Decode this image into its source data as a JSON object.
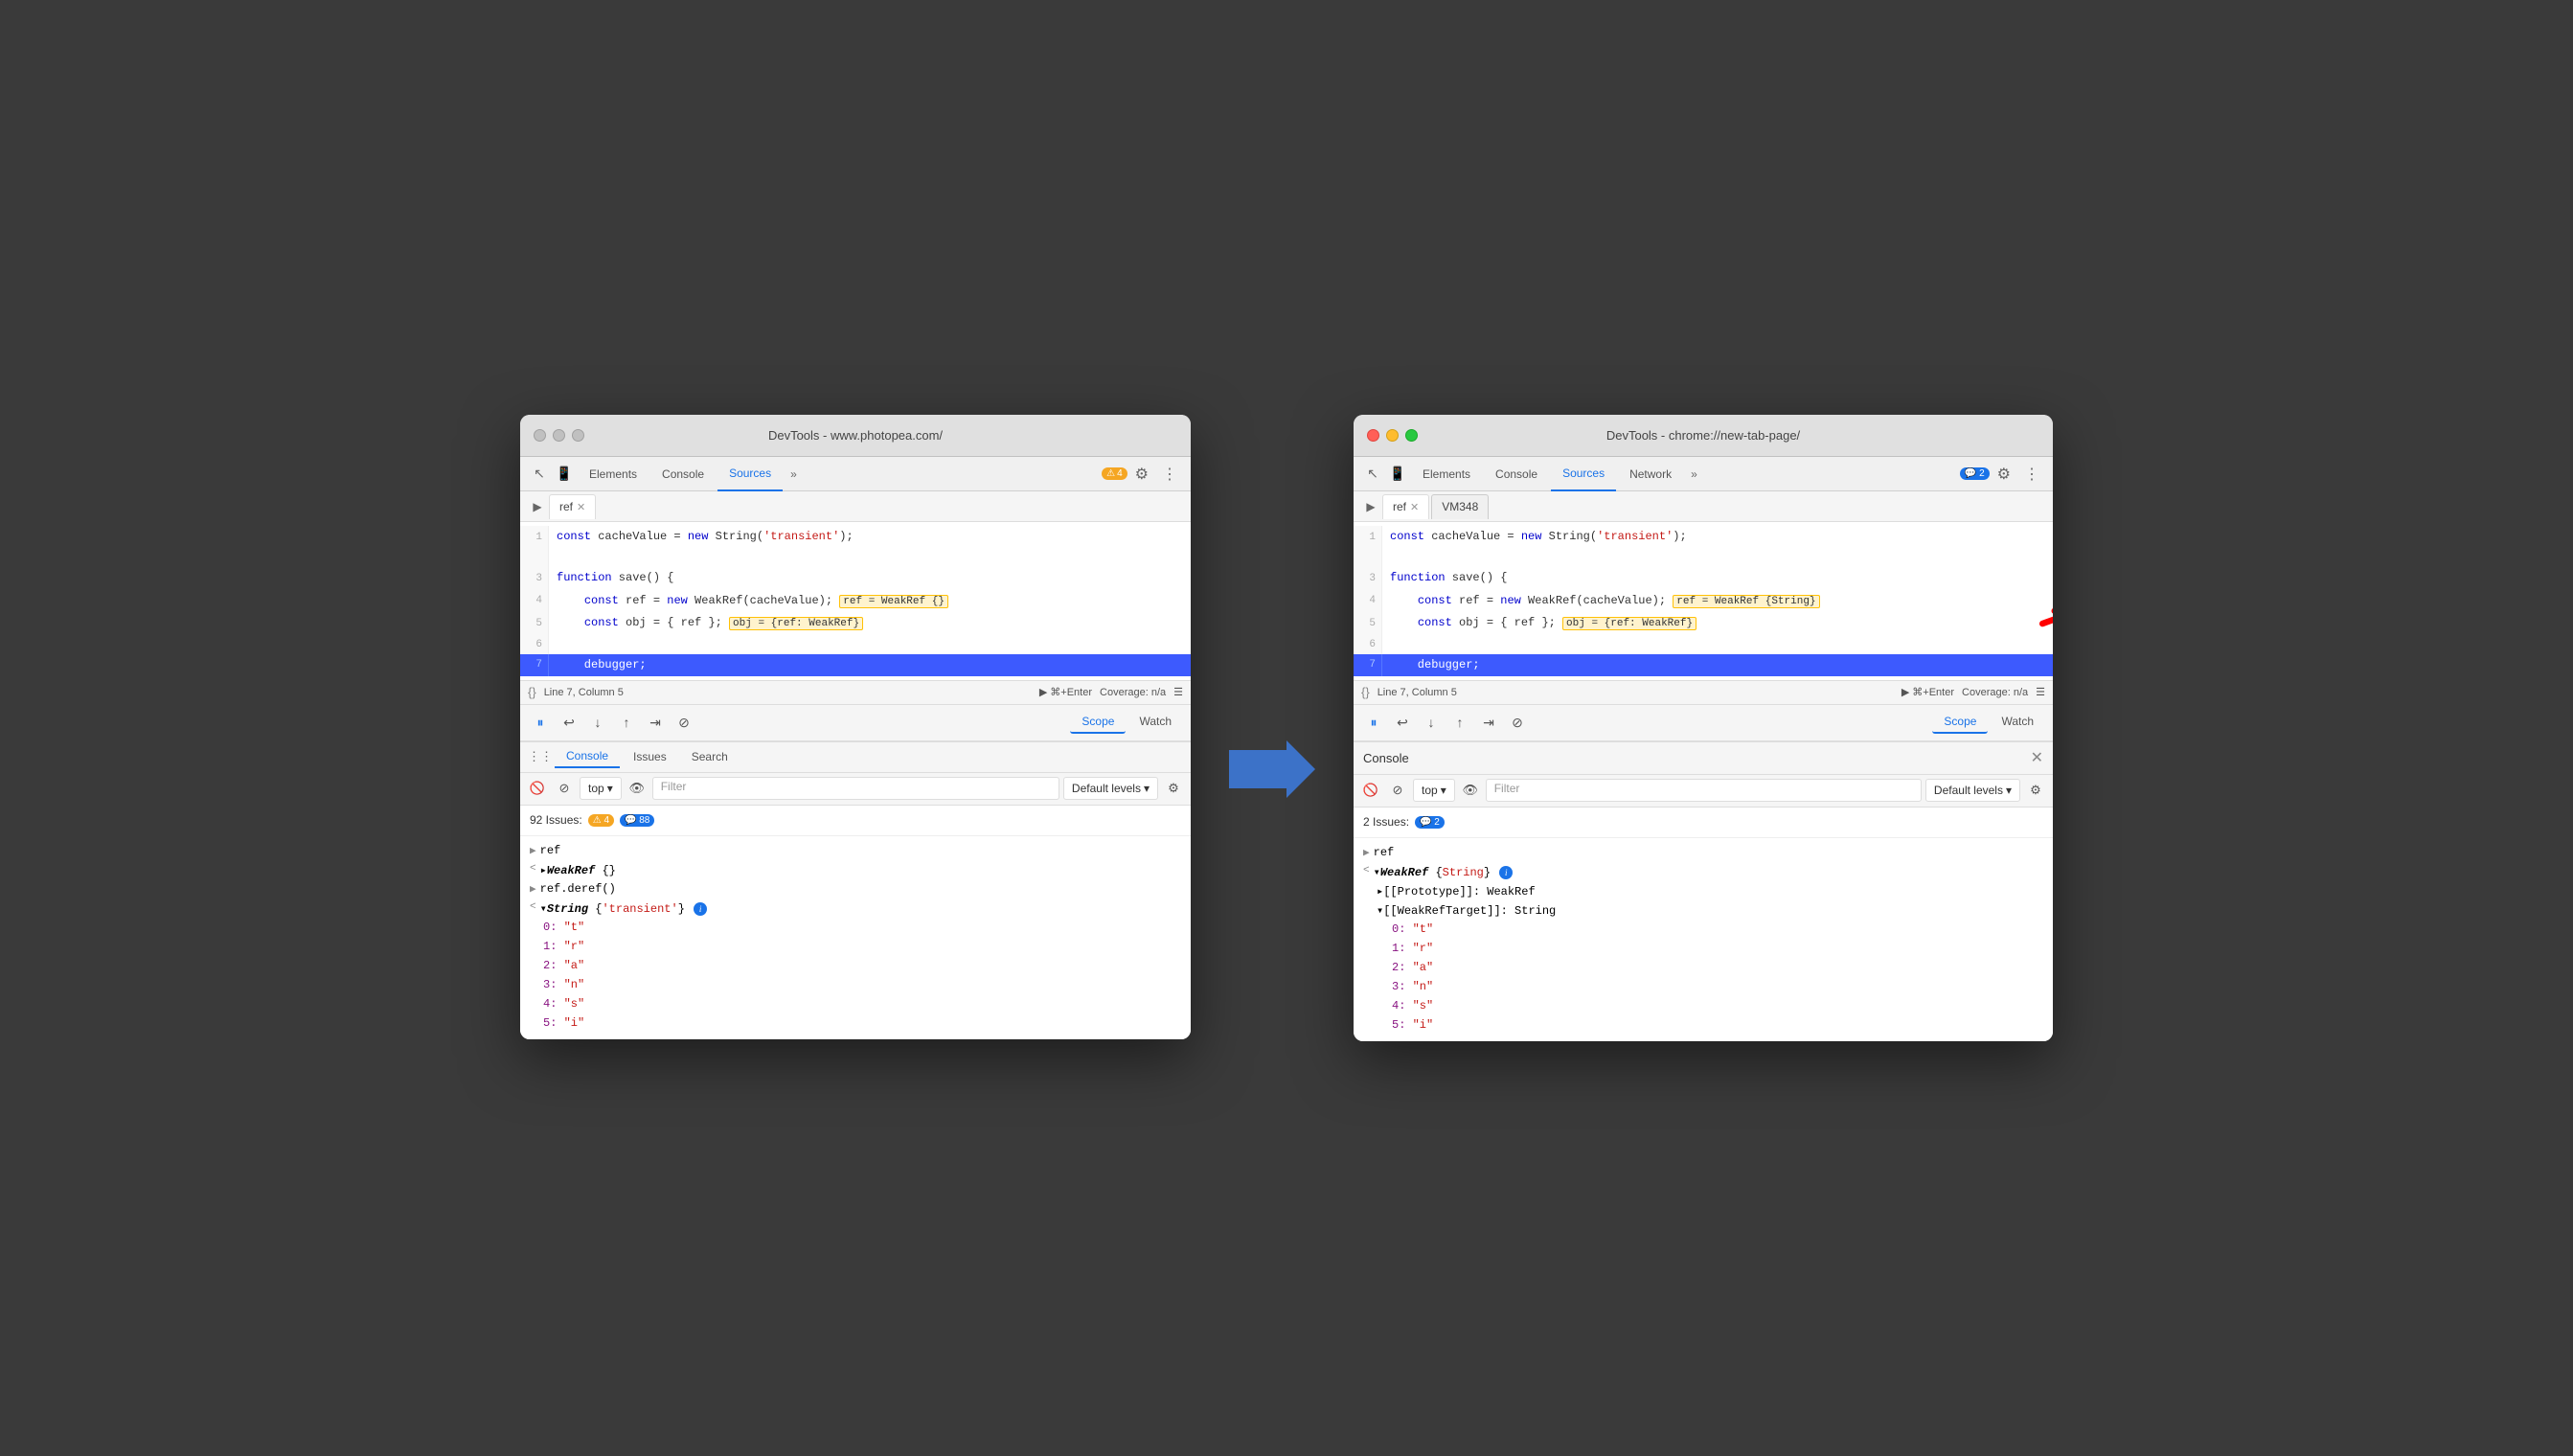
{
  "left_window": {
    "title": "DevTools - www.photopea.com/",
    "nav_tabs": [
      "Elements",
      "Console",
      "Sources"
    ],
    "active_tab": "Sources",
    "file_tab": "ref",
    "code_lines": [
      {
        "num": 1,
        "content": "const cacheValue = new String('transient');"
      },
      {
        "num": 3,
        "content": "function save() {"
      },
      {
        "num": 4,
        "content": "    const ref = new WeakRef(cacheValue);",
        "annotation": " ref = WeakRef {}"
      },
      {
        "num": 5,
        "content": "    const obj = { ref };",
        "annotation": " obj = {ref: WeakRef}"
      },
      {
        "num": 6,
        "content": ""
      },
      {
        "num": 7,
        "content": "    debugger;",
        "active": true
      }
    ],
    "status_line": "Line 7, Column 5",
    "coverage": "Coverage: n/a",
    "debug_tabs": [
      "Scope",
      "Watch"
    ],
    "bottom_tabs": [
      "Console",
      "Issues",
      "Search"
    ],
    "active_bottom_tab": "Console",
    "top_label": "top",
    "filter_placeholder": "Filter",
    "default_levels": "Default levels",
    "issues_count": "92 Issues:",
    "warn_count": "4",
    "info_count": "88",
    "console_items": [
      {
        "type": "ref",
        "text": "ref"
      },
      {
        "type": "weakref",
        "text": "▸WeakRef {}"
      },
      {
        "type": "ref_deref",
        "text": "ref.deref()"
      },
      {
        "type": "string_obj",
        "text": "▾String {'transient'}",
        "has_info": true
      },
      {
        "type": "str_0",
        "text": "0: \"t\""
      },
      {
        "type": "str_1",
        "text": "1: \"r\""
      },
      {
        "type": "str_2",
        "text": "2: \"a\""
      },
      {
        "type": "str_3",
        "text": "3: \"n\""
      },
      {
        "type": "str_4",
        "text": "4: \"s\""
      },
      {
        "type": "str_5",
        "text": "5: \"i\""
      }
    ]
  },
  "right_window": {
    "title": "DevTools - chrome://new-tab-page/",
    "nav_tabs": [
      "Elements",
      "Console",
      "Sources",
      "Network"
    ],
    "active_tab": "Sources",
    "file_tabs": [
      "ref",
      "VM348"
    ],
    "active_file": "ref",
    "code_lines": [
      {
        "num": 1,
        "content": "const cacheValue = new String('transient');"
      },
      {
        "num": 3,
        "content": "function save() {"
      },
      {
        "num": 4,
        "content": "    const ref = new WeakRef(cacheValue);",
        "annotation": " ref = WeakRef {String}"
      },
      {
        "num": 5,
        "content": "    const obj = { ref };",
        "annotation": " obj = {ref: WeakRef}"
      },
      {
        "num": 6,
        "content": ""
      },
      {
        "num": 7,
        "content": "    debugger;",
        "active": true
      }
    ],
    "status_line": "Line 7, Column 5",
    "coverage": "Coverage: n/a",
    "debug_tabs": [
      "Scope",
      "Watch"
    ],
    "active_debug_tab": "Scope",
    "console_title": "Console",
    "top_label": "top",
    "filter_placeholder": "Filter",
    "default_levels": "Default levels",
    "issues_count": "2 Issues:",
    "info_count": "2",
    "console_items": [
      {
        "text": "ref"
      },
      {
        "text": "▾WeakRef {String}",
        "has_info": true
      },
      {
        "text": "▸[[Prototype]]: WeakRef",
        "indent": 1
      },
      {
        "text": "▾[[WeakRefTarget]]: String",
        "indent": 1
      },
      {
        "text": "0: \"t\"",
        "indent": 2
      },
      {
        "text": "1: \"r\"",
        "indent": 2
      },
      {
        "text": "2: \"a\"",
        "indent": 2
      },
      {
        "text": "3: \"n\"",
        "indent": 2
      },
      {
        "text": "4: \"s\"",
        "indent": 2
      },
      {
        "text": "5: \"i\"",
        "indent": 2
      }
    ]
  }
}
